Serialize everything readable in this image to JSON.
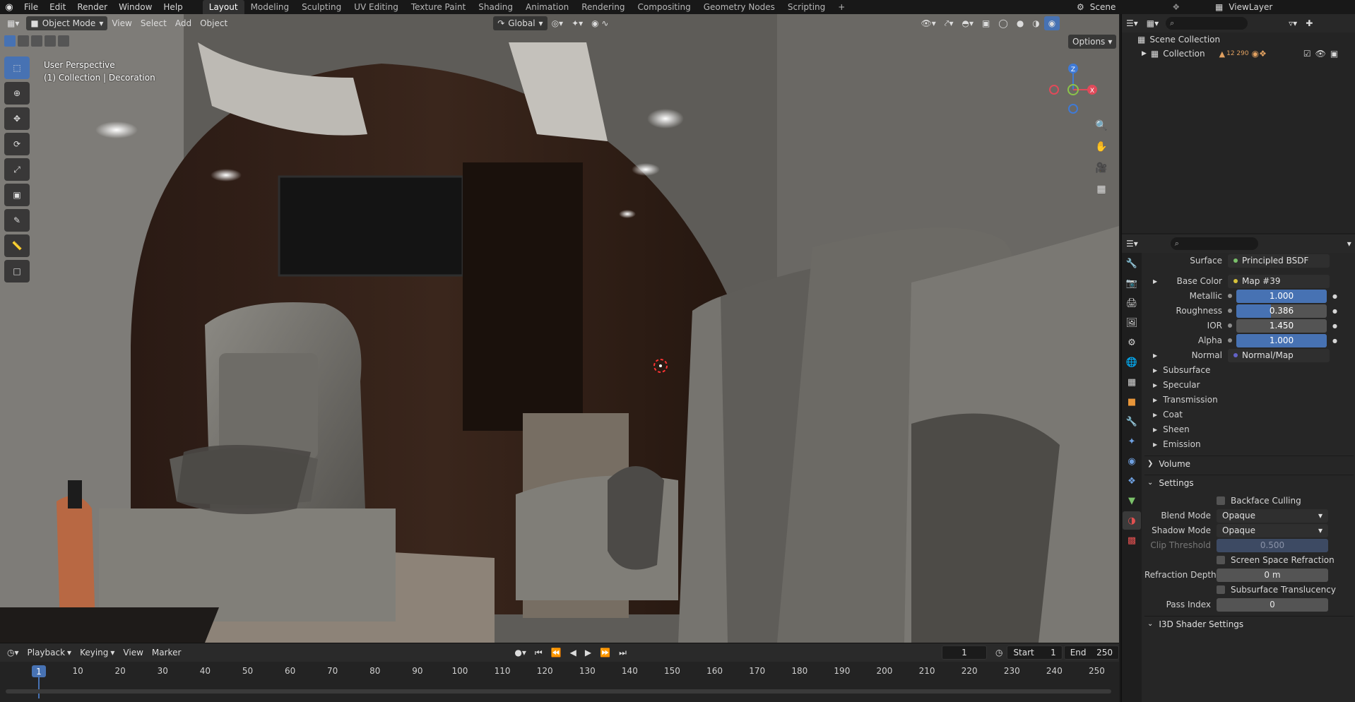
{
  "topbar": {
    "menus": [
      "File",
      "Edit",
      "Render",
      "Window",
      "Help"
    ],
    "workspaces": [
      "Layout",
      "Modeling",
      "Sculpting",
      "UV Editing",
      "Texture Paint",
      "Shading",
      "Animation",
      "Rendering",
      "Compositing",
      "Geometry Nodes",
      "Scripting"
    ],
    "active_workspace": "Layout",
    "add_tab": "+",
    "scene": "Scene",
    "view_layer": "ViewLayer"
  },
  "viewport": {
    "mode": "Object Mode",
    "menus": [
      "View",
      "Select",
      "Add",
      "Object"
    ],
    "transform_orientation": "Global",
    "options": "Options",
    "overlay_line1": "User Perspective",
    "overlay_line2": "(1) Collection | Decoration",
    "gizmo_axes": [
      "X",
      "Y",
      "Z"
    ]
  },
  "timeline": {
    "menus": [
      "Playback",
      "Keying",
      "View",
      "Marker"
    ],
    "current_frame": "1",
    "start_label": "Start",
    "start_value": "1",
    "end_label": "End",
    "end_value": "250",
    "ticks": [
      "10",
      "20",
      "30",
      "40",
      "50",
      "60",
      "70",
      "80",
      "90",
      "100",
      "110",
      "120",
      "130",
      "140",
      "150",
      "160",
      "170",
      "180",
      "190",
      "200",
      "210",
      "220",
      "230",
      "240",
      "250"
    ],
    "marker_label": "1"
  },
  "outliner": {
    "root": "Scene Collection",
    "collection": "Collection",
    "collection_count": "12 290"
  },
  "properties": {
    "surface_label": "Surface",
    "surface_value": "Principled BSDF",
    "base_color_label": "Base Color",
    "base_color_value": "Map #39",
    "metallic_label": "Metallic",
    "metallic_value": "1.000",
    "metallic_fraction": 1.0,
    "roughness_label": "Roughness",
    "roughness_value": "0.386",
    "roughness_fraction": 0.386,
    "ior_label": "IOR",
    "ior_value": "1.450",
    "alpha_label": "Alpha",
    "alpha_value": "1.000",
    "alpha_fraction": 1.0,
    "normal_label": "Normal",
    "normal_value": "Normal/Map",
    "subpanels": [
      "Subsurface",
      "Specular",
      "Transmission",
      "Coat",
      "Sheen",
      "Emission"
    ],
    "volume": "Volume",
    "settings": "Settings",
    "backface_culling": "Backface Culling",
    "blend_mode_label": "Blend Mode",
    "blend_mode_value": "Opaque",
    "shadow_mode_label": "Shadow Mode",
    "shadow_mode_value": "Opaque",
    "clip_threshold_label": "Clip Threshold",
    "clip_threshold_value": "0.500",
    "screen_space_refraction": "Screen Space Refraction",
    "refraction_depth_label": "Refraction Depth",
    "refraction_depth_value": "0 m",
    "subsurface_translucency": "Subsurface Translucency",
    "pass_index_label": "Pass Index",
    "pass_index_value": "0",
    "i3d_shader": "I3D Shader Settings"
  },
  "colors": {
    "accent": "#4772b3",
    "axis_x": "#e04a5a",
    "axis_y": "#8bc34a",
    "axis_z": "#3f7ad6"
  }
}
